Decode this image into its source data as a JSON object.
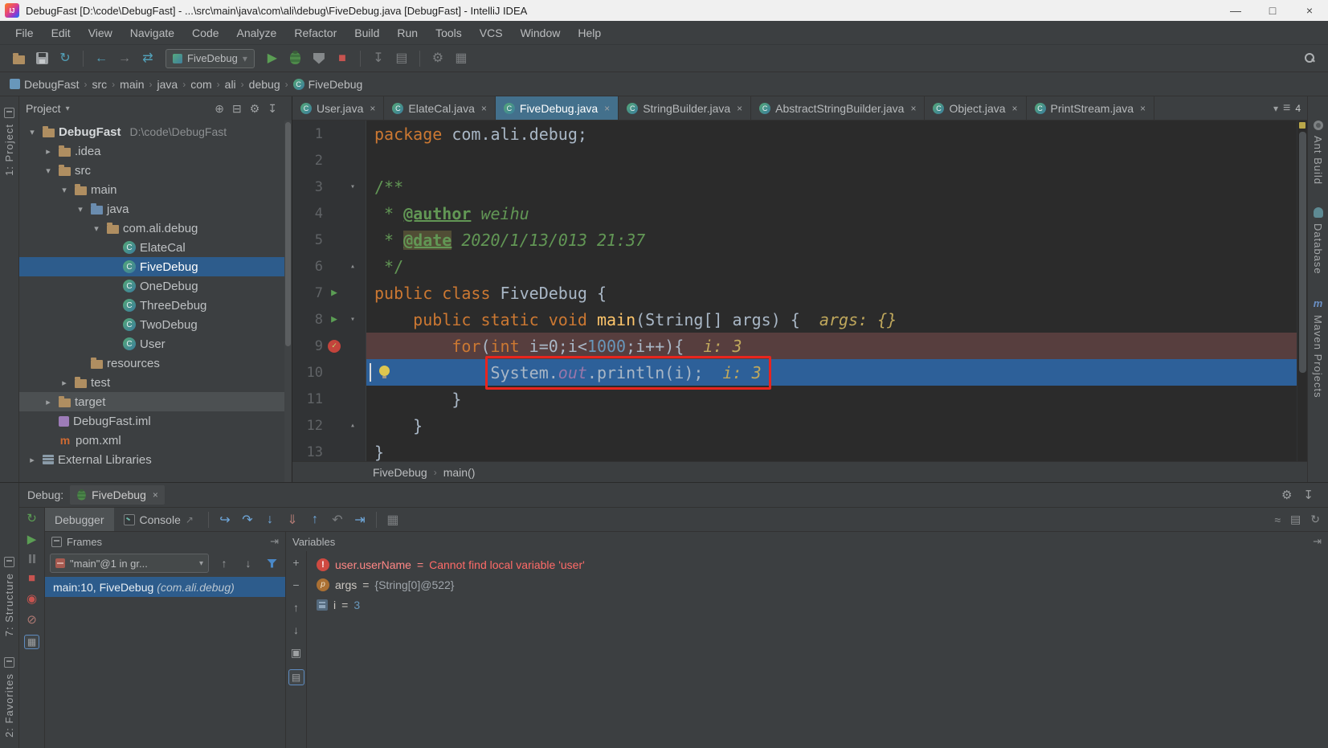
{
  "window": {
    "title": "DebugFast [D:\\code\\DebugFast] - ...\\src\\main\\java\\com\\ali\\debug\\FiveDebug.java [DebugFast] - IntelliJ IDEA"
  },
  "menu": [
    "File",
    "Edit",
    "View",
    "Navigate",
    "Code",
    "Analyze",
    "Refactor",
    "Build",
    "Run",
    "Tools",
    "VCS",
    "Window",
    "Help"
  ],
  "toolbar": {
    "run_config": "FiveDebug"
  },
  "navbar": [
    "DebugFast",
    "src",
    "main",
    "java",
    "com",
    "ali",
    "debug",
    "FiveDebug"
  ],
  "strips": {
    "left_top": "1: Project",
    "left_bottom": [
      "7: Structure",
      "2: Favorites"
    ],
    "right": [
      "Ant Build",
      "Database",
      "Maven Projects"
    ]
  },
  "project": {
    "header": "Project",
    "tree": [
      {
        "label": "DebugFast",
        "hint": "D:\\code\\DebugFast",
        "icon": "folder",
        "level": 0,
        "arrow": "expanded",
        "bold": true
      },
      {
        "label": ".idea",
        "icon": "folder",
        "level": 1,
        "arrow": "collapsed"
      },
      {
        "label": "src",
        "icon": "folder",
        "level": 1,
        "arrow": "expanded"
      },
      {
        "label": "main",
        "icon": "folder",
        "level": 2,
        "arrow": "expanded"
      },
      {
        "label": "java",
        "icon": "folder-src",
        "level": 3,
        "arrow": "expanded"
      },
      {
        "label": "com.ali.debug",
        "icon": "folder",
        "level": 4,
        "arrow": "expanded"
      },
      {
        "label": "ElateCal",
        "icon": "class",
        "level": 5
      },
      {
        "label": "FiveDebug",
        "icon": "class",
        "level": 5,
        "selected": true
      },
      {
        "label": "OneDebug",
        "icon": "class",
        "level": 5
      },
      {
        "label": "ThreeDebug",
        "icon": "class",
        "level": 5
      },
      {
        "label": "TwoDebug",
        "icon": "class",
        "level": 5
      },
      {
        "label": "User",
        "icon": "class",
        "level": 5
      },
      {
        "label": "resources",
        "icon": "folder",
        "level": 3
      },
      {
        "label": "test",
        "icon": "folder",
        "level": 2,
        "arrow": "collapsed"
      },
      {
        "label": "target",
        "icon": "folder",
        "level": 1,
        "arrow": "collapsed",
        "soft": true
      },
      {
        "label": "DebugFast.iml",
        "icon": "iml",
        "level": 1
      },
      {
        "label": "pom.xml",
        "icon": "maven",
        "level": 1
      },
      {
        "label": "External Libraries",
        "icon": "libs",
        "level": 0,
        "arrow": "collapsed"
      }
    ]
  },
  "editor": {
    "tabs": [
      {
        "label": "User.java"
      },
      {
        "label": "ElateCal.java"
      },
      {
        "label": "FiveDebug.java",
        "active": true
      },
      {
        "label": "StringBuilder.java"
      },
      {
        "label": "AbstractStringBuilder.java"
      },
      {
        "label": "Object.java"
      },
      {
        "label": "PrintStream.java"
      }
    ],
    "tabs_overflow": "4",
    "breadcrumb": [
      "FiveDebug",
      "main()"
    ],
    "lines": [
      {
        "n": 1,
        "tokens": [
          {
            "t": "package ",
            "c": "kw"
          },
          {
            "t": "com.ali.debug;",
            "c": "pl"
          }
        ]
      },
      {
        "n": 2,
        "tokens": []
      },
      {
        "n": 3,
        "fold": "open",
        "tokens": [
          {
            "t": "/**",
            "c": "doc"
          }
        ]
      },
      {
        "n": 4,
        "tokens": [
          {
            "t": " * ",
            "c": "doc"
          },
          {
            "t": "@author",
            "c": "doctag"
          },
          {
            "t": " weihu",
            "c": "docval"
          }
        ]
      },
      {
        "n": 5,
        "tokens": [
          {
            "t": " * ",
            "c": "doc"
          },
          {
            "t": "@date",
            "c": "doctag hl"
          },
          {
            "t": " 2020/1/13/013 21:37",
            "c": "docval"
          }
        ]
      },
      {
        "n": 6,
        "fold": "close",
        "tokens": [
          {
            "t": " */",
            "c": "doc"
          }
        ]
      },
      {
        "n": 7,
        "run": true,
        "tokens": [
          {
            "t": "public class ",
            "c": "kw"
          },
          {
            "t": "FiveDebug {",
            "c": "pl"
          }
        ]
      },
      {
        "n": 8,
        "run": true,
        "fold": "open",
        "tokens": [
          {
            "t": "    ",
            "c": "pl"
          },
          {
            "t": "public static void ",
            "c": "kw"
          },
          {
            "t": "main",
            "c": "fn"
          },
          {
            "t": "(String[] args) {",
            "c": "pl"
          },
          {
            "t": "  args: {}",
            "c": "hint"
          }
        ]
      },
      {
        "n": 9,
        "bp": true,
        "bg": "bp",
        "tokens": [
          {
            "t": "        ",
            "c": "pl"
          },
          {
            "t": "for",
            "c": "kw"
          },
          {
            "t": "(",
            "c": "pl"
          },
          {
            "t": "int ",
            "c": "kw"
          },
          {
            "t": "i=0;i<",
            "c": "pl"
          },
          {
            "t": "1000",
            "c": "num"
          },
          {
            "t": ";i++){",
            "c": "pl"
          },
          {
            "t": "  i: 3",
            "c": "hint"
          }
        ]
      },
      {
        "n": 10,
        "bg": "exec",
        "bulb": true,
        "caret": true,
        "annot": true,
        "tokens": [
          {
            "t": "            ",
            "c": "pl"
          },
          {
            "t": "System.",
            "c": "pl"
          },
          {
            "t": "out",
            "c": "fld"
          },
          {
            "t": ".println(i);",
            "c": "pl"
          },
          {
            "t": "  i: 3",
            "c": "hint"
          }
        ]
      },
      {
        "n": 11,
        "tokens": [
          {
            "t": "        }",
            "c": "pl"
          }
        ]
      },
      {
        "n": 12,
        "fold": "close",
        "tokens": [
          {
            "t": "    }",
            "c": "pl"
          }
        ]
      },
      {
        "n": 13,
        "tokens": [
          {
            "t": "}",
            "c": "pl"
          }
        ]
      }
    ]
  },
  "debug": {
    "label": "Debug:",
    "session_tab": "FiveDebug",
    "tabs": [
      "Debugger",
      "Console"
    ],
    "frames": {
      "title": "Frames",
      "thread": "\"main\"@1 in gr...",
      "rows": [
        {
          "text": "main:10, FiveDebug ",
          "pkg": "(com.ali.debug)",
          "selected": true
        }
      ]
    },
    "variables": {
      "title": "Variables",
      "eq": " = ",
      "rows": [
        {
          "icon": "error",
          "name": "user.userName",
          "value": "Cannot find local variable 'user'"
        },
        {
          "icon": "param",
          "name": "args",
          "value": "{String[0]@522}"
        },
        {
          "icon": "primitive",
          "name": "i",
          "value": "3"
        }
      ]
    }
  },
  "icons": {
    "minimize": "—",
    "maximize": "□",
    "close": "×",
    "close_tab": "×",
    "chevron": "›",
    "caret_down": "▾",
    "tree_expanded": "▾",
    "tree_collapsed": "▸",
    "fold_open": "▾",
    "fold_close": "▴",
    "run_arrow": "▶",
    "check": "✓",
    "class_letter": "C",
    "maven_letter": "m",
    "bang": "!",
    "param_letter": "p",
    "back": "←",
    "forward": "→",
    "sync": "↻",
    "compare": "⇄",
    "run": "▶",
    "stop": "■",
    "rerun": "↻",
    "locate": "⊕",
    "collapse_all": "⊟",
    "settings": "⚙",
    "hide": "↧",
    "show_exec": "↪",
    "step_over": "↷",
    "step_into": "↓",
    "force_step_into": "⇓",
    "step_out": "↑",
    "drop_frame": "↶",
    "run_to_cursor": "⇥",
    "evaluate": "▦",
    "stream": "≈",
    "layout": "▤",
    "reload": "↻",
    "up": "↑",
    "down": "↓",
    "plus": "+",
    "minus": "−",
    "duplicate": "▣",
    "external": "↗",
    "pin": "⇥",
    "overflow": "≡",
    "view_breakpoints": "◉",
    "mute_breakpoints": "⊘"
  },
  "colors": {
    "accent": "#2d5c8c",
    "exec_line": "#2d6099",
    "breakpoint_line": "#573e3e",
    "error": "#ff6b68"
  }
}
